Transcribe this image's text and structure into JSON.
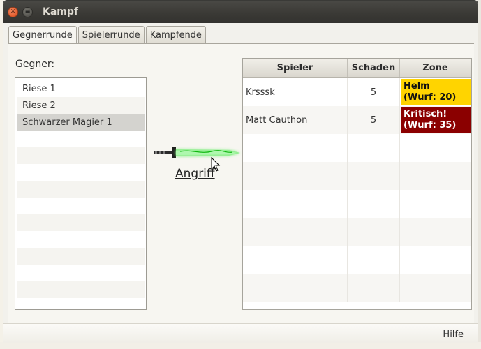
{
  "window": {
    "title": "Kampf"
  },
  "tabs": [
    {
      "label": "Gegnerrunde",
      "active": true
    },
    {
      "label": "Spielerrunde",
      "active": false
    },
    {
      "label": "Kampfende",
      "active": false
    }
  ],
  "gegner": {
    "label": "Gegner:",
    "items": [
      "Riese 1",
      "Riese 2",
      "Schwarzer Magier 1"
    ],
    "selected": "Schwarzer Magier 1"
  },
  "attack": {
    "label": "Angriff",
    "icon": "sword-icon"
  },
  "table": {
    "headers": [
      "Spieler",
      "Schaden",
      "Zone"
    ],
    "rows": [
      {
        "spieler": "Krsssk",
        "schaden": "5",
        "zone_line1": "Helm",
        "zone_line2": "(Wurf: 20)",
        "zone_color": "#ffd400"
      },
      {
        "spieler": "Matt Cauthon",
        "schaden": "5",
        "zone_line1": "Kritisch!",
        "zone_line2": "(Wurf: 35)",
        "zone_color": "#8b0000"
      }
    ]
  },
  "footer": {
    "help_label": "Hilfe"
  }
}
